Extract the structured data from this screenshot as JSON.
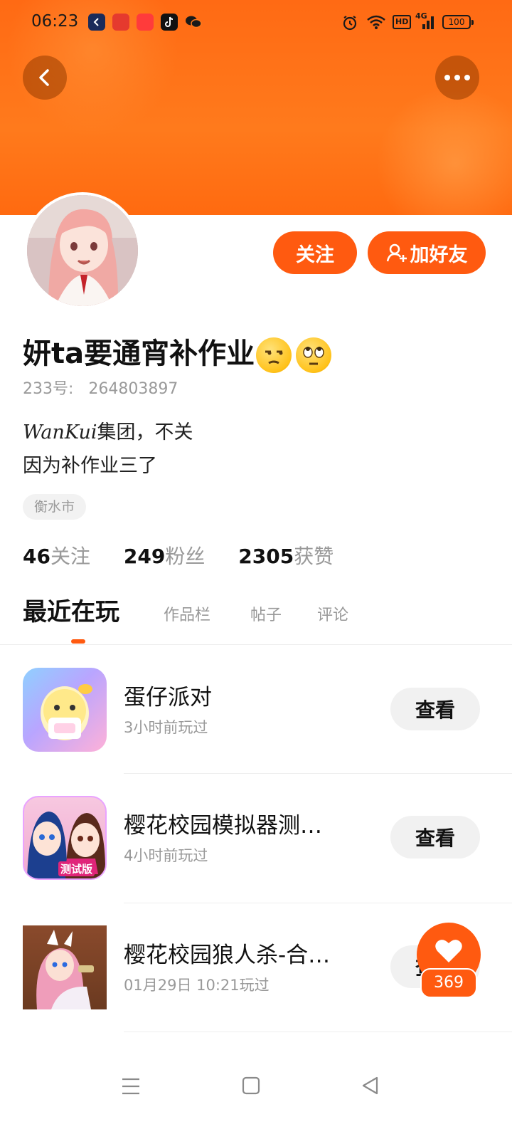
{
  "status_bar": {
    "time": "06:23",
    "hd": "HD",
    "network": "4G",
    "battery": "100"
  },
  "profile": {
    "follow_button": "关注",
    "add_friend_button": "加好友",
    "name": "妍ta要通宵补作业",
    "uid_label": "233号:",
    "uid_value": "264803897",
    "bio_line1_script": "WanKui",
    "bio_line1_rest": "集团，不关",
    "bio_line2": "因为补作业三了",
    "location": "衡水市",
    "stats": [
      {
        "value": "46",
        "label": "关注"
      },
      {
        "value": "249",
        "label": "粉丝"
      },
      {
        "value": "2305",
        "label": "获赞"
      }
    ]
  },
  "tabs": [
    "最近在玩",
    "作品栏",
    "帖子",
    "评论"
  ],
  "games": [
    {
      "title": "蛋仔派对",
      "subtitle": "3小时前玩过",
      "button": "查看",
      "icon": "eggy-party-icon"
    },
    {
      "title": "樱花校园模拟器测…",
      "subtitle": "4小时前玩过",
      "button": "查看",
      "icon": "sakura-school-test-icon",
      "badge": "测试版"
    },
    {
      "title": "樱花校园狼人杀-合…",
      "subtitle": "01月29日 10:21玩过",
      "button": "查看",
      "icon": "sakura-werewolf-icon"
    }
  ],
  "like": {
    "count": "369"
  },
  "colors": {
    "accent": "#ff5a10",
    "banner": "#ff7a1c"
  }
}
